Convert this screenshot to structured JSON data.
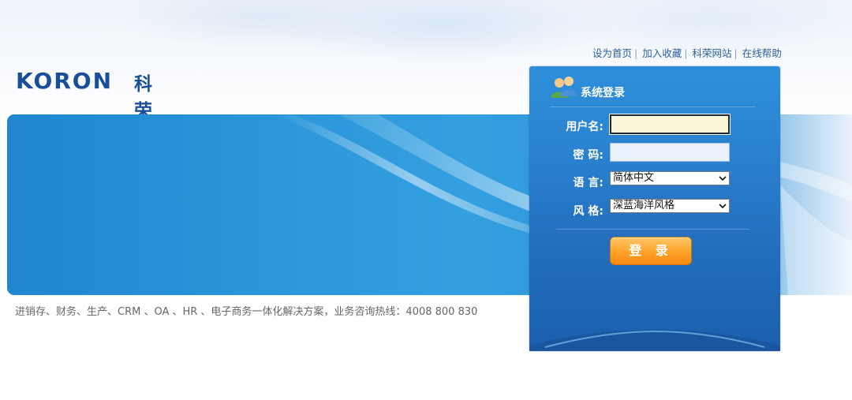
{
  "header": {
    "links": [
      {
        "label": "设为首页"
      },
      {
        "label": "加入收藏"
      },
      {
        "label": "科荣网站"
      },
      {
        "label": "在线帮助"
      }
    ],
    "separator": "|"
  },
  "logo": {
    "text_en": "KORON",
    "text_cn": "科荣"
  },
  "tagline": "进销存、财务、生产、CRM 、OA 、HR 、电子商务一体化解决方案，业务咨询热线：4008 800 830",
  "login": {
    "title": "系统登录",
    "username_label": "用户名:",
    "username_value": "",
    "password_label": "密 码:",
    "password_value": "",
    "language_label": "语 言:",
    "language_value": "简体中文",
    "style_label": "风 格:",
    "style_value": "深蓝海洋风格",
    "submit_label": "登 录"
  },
  "colors": {
    "brand": "#1a4e98",
    "panel": "#2a82d0",
    "button": "#ffa52c",
    "link": "#2b5f97"
  }
}
